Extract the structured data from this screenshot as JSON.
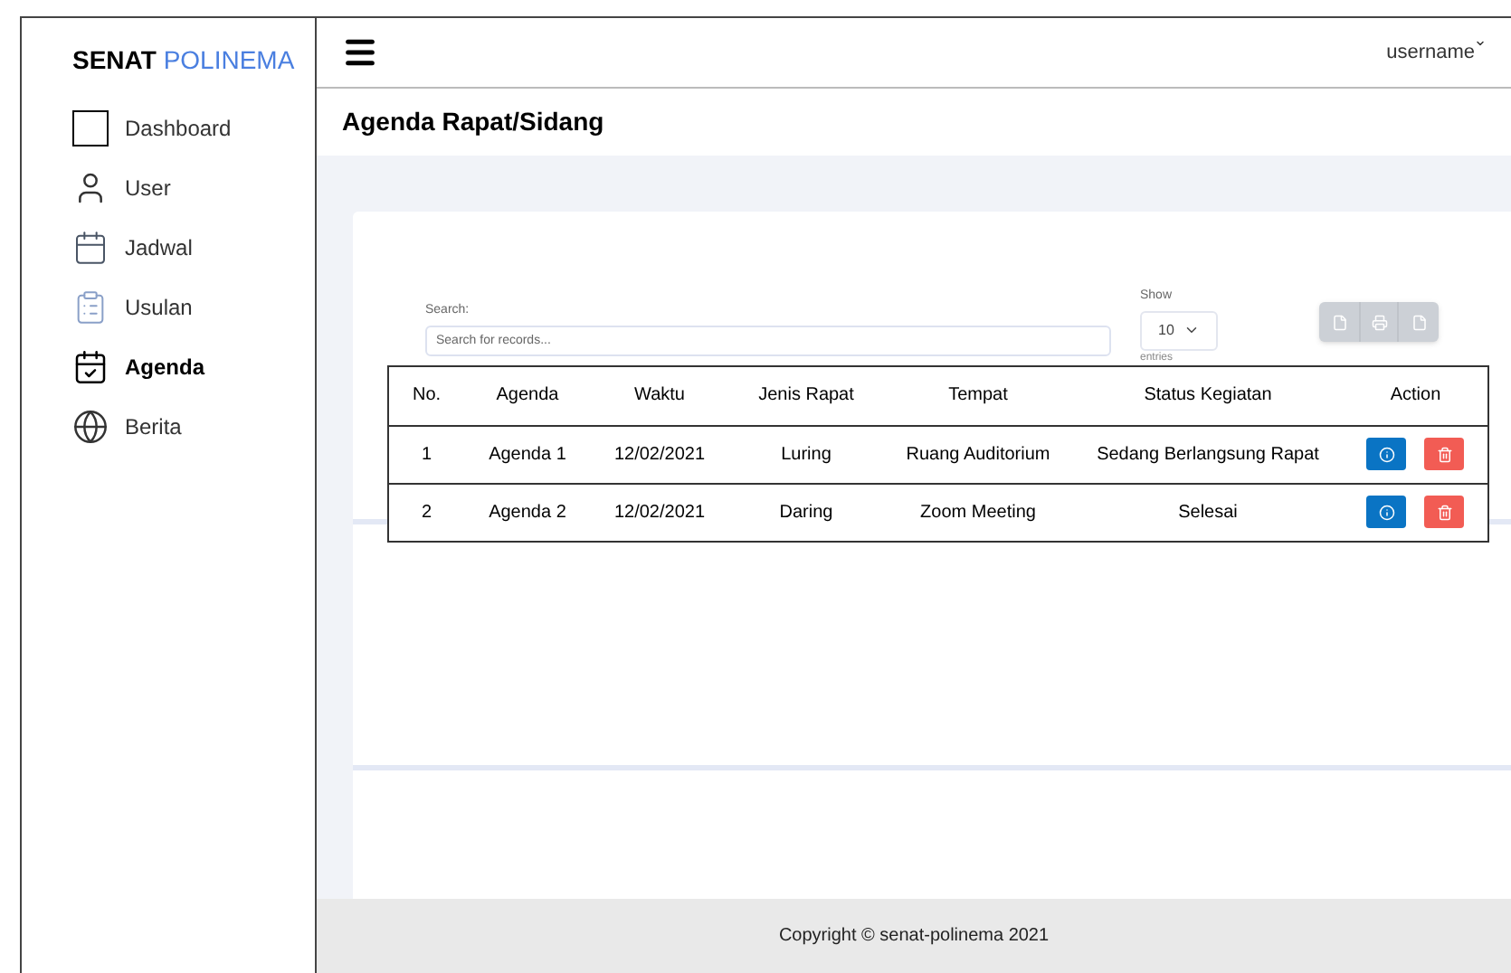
{
  "brand": {
    "first": "SENAT",
    "second": "POLINEMA"
  },
  "sidebar": {
    "items": [
      {
        "label": "Dashboard",
        "kind": "square",
        "selected": false
      },
      {
        "label": "User",
        "kind": "user",
        "selected": false
      },
      {
        "label": "Jadwal",
        "kind": "schedule",
        "selected": false
      },
      {
        "label": "Usulan",
        "kind": "clipboard",
        "selected": false
      },
      {
        "label": "Agenda",
        "kind": "calendar",
        "selected": true
      },
      {
        "label": "Berita",
        "kind": "news",
        "selected": false
      }
    ]
  },
  "header": {
    "user": "username"
  },
  "page_title": "Agenda Rapat/Sidang",
  "search": {
    "label": "Search:",
    "placeholder": "Search for records..."
  },
  "show": {
    "label": "Show",
    "value": "10",
    "suffix": "entries"
  },
  "table": {
    "columns": [
      "No.",
      "Agenda",
      "Waktu",
      "Jenis Rapat",
      "Tempat",
      "Status Kegiatan",
      "Action"
    ],
    "rows": [
      [
        "1",
        "Agenda 1",
        "12/02/2021",
        "Luring",
        "Ruang Auditorium",
        "Sedang Berlangsung Rapat"
      ],
      [
        "2",
        "Agenda 2",
        "12/02/2021",
        "Daring",
        "Zoom Meeting",
        "Selesai"
      ]
    ]
  },
  "footer": "Copyright © senat-polinema 2021"
}
